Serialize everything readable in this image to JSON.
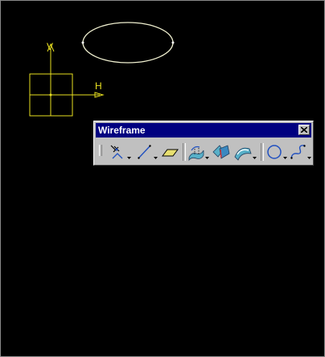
{
  "workspace": {
    "background": "#000000",
    "axis_color": "#e8e020",
    "ellipse_color": "#f0f0d0",
    "axis_v_label": "V",
    "axis_h_label": "H"
  },
  "toolbar": {
    "title": "Wireframe",
    "title_bar_color": "#000080",
    "close_icon": "close-x-icon",
    "buttons": [
      {
        "name": "point-icon",
        "has_dropdown": true
      },
      {
        "name": "line-icon",
        "has_dropdown": true
      },
      {
        "name": "plane-icon",
        "has_dropdown": false
      },
      {
        "name": "projection-icon",
        "has_dropdown": true
      },
      {
        "name": "intersection-icon",
        "has_dropdown": false
      },
      {
        "name": "offset-curve-icon",
        "has_dropdown": true
      },
      {
        "name": "circle-icon",
        "has_dropdown": true
      },
      {
        "name": "spline-icon",
        "has_dropdown": true
      }
    ]
  }
}
